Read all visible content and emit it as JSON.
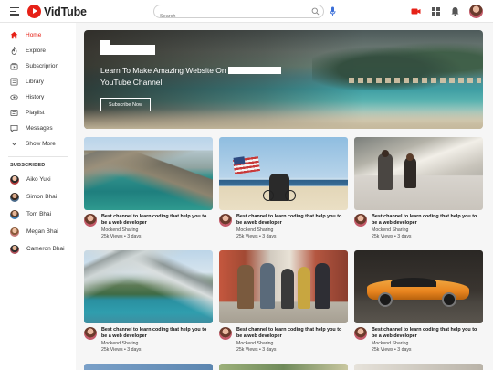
{
  "header": {
    "brand": "VidTube",
    "search_placeholder": "Search"
  },
  "sidebar": {
    "items": [
      {
        "label": "Home",
        "icon": "home-icon",
        "active": true
      },
      {
        "label": "Explore",
        "icon": "explore-icon"
      },
      {
        "label": "Subscriprion",
        "icon": "subscriptions-icon"
      },
      {
        "label": "Library",
        "icon": "library-icon"
      },
      {
        "label": "History",
        "icon": "history-icon"
      },
      {
        "label": "Playlist",
        "icon": "playlist-icon"
      },
      {
        "label": "Messages",
        "icon": "messages-icon"
      },
      {
        "label": "Show More",
        "icon": "chevron-down-icon"
      }
    ],
    "subscribed_title": "SUBSCRIBED",
    "subscriptions": [
      {
        "name": "Aiko Yuki"
      },
      {
        "name": "Simon Bhai"
      },
      {
        "name": "Tom Bhai"
      },
      {
        "name": "Megan Bhai"
      },
      {
        "name": "Cameron Bhai"
      }
    ]
  },
  "banner": {
    "title_line1": "Learn To Make Amazing Website On",
    "title_line2": "YouTube Channel",
    "button": "Subscribe Now"
  },
  "videos": [
    {
      "title": "Best channel to learn coding that help you to be a web developer",
      "channel": "Mockend Sharing",
      "meta": "25k Views • 3 days"
    },
    {
      "title": "Best channel to learn coding that help you to be a web developer",
      "channel": "Mockend Sharing",
      "meta": "25k Views • 3 days"
    },
    {
      "title": "Best channel to learn coding that help you to be a web developer",
      "channel": "Mockend Sharing",
      "meta": "25k Views • 3 days"
    },
    {
      "title": "Best channel to learn coding that help you to be a web developer",
      "channel": "Mockend Sharing",
      "meta": "25k Views • 3 days"
    },
    {
      "title": "Best channel to learn coding that help you to be a web developer",
      "channel": "Mockend Sharing",
      "meta": "25k Views • 3 days"
    },
    {
      "title": "Best channel to learn coding that help you to be a web developer",
      "channel": "Mockend Sharing",
      "meta": "25k Views • 3 days"
    }
  ],
  "colors": {
    "accent": "#e62117",
    "sidebar_bg": "#ffffff",
    "page_bg": "#f6f6f6"
  }
}
